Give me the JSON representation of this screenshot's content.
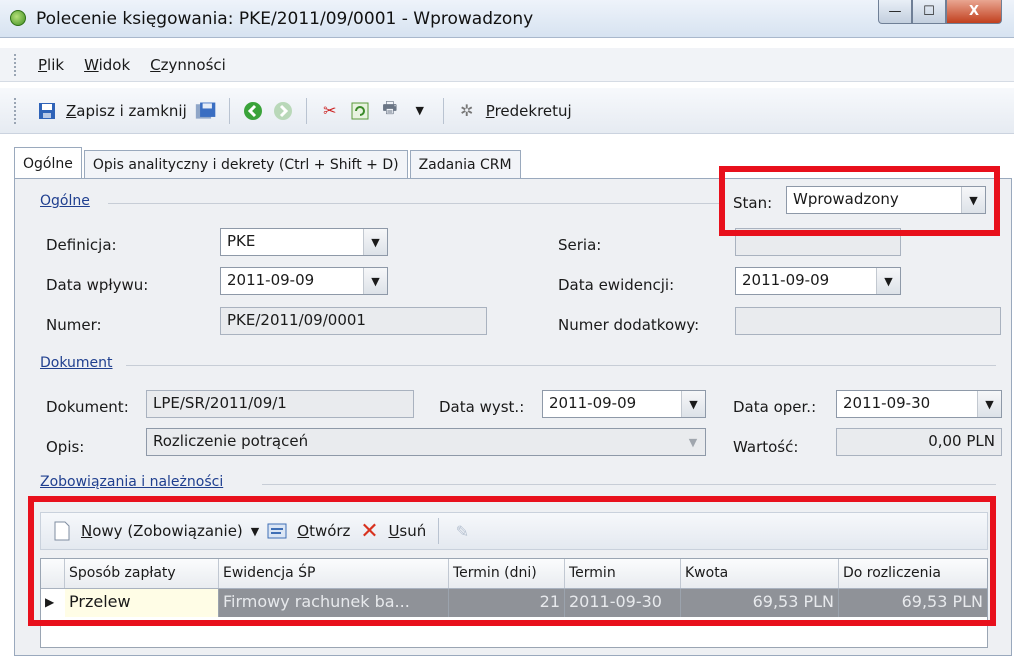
{
  "window": {
    "title": "Polecenie księgowania: PKE/2011/09/0001 - Wprowadzony",
    "min": "—",
    "max": "☐",
    "close": "X"
  },
  "menu": [
    {
      "label_u": "P",
      "label_rest": "lik"
    },
    {
      "label_u": "W",
      "label_rest": "idok"
    },
    {
      "label_u": "C",
      "label_rest": "zynności"
    }
  ],
  "toolbar": {
    "save_close_u": "Z",
    "save_close_rest": "apisz i zamknij",
    "predekretuj_u": "P",
    "predekretuj_rest": "redekretuj"
  },
  "tabs": [
    "Ogólne",
    "Opis analityczny i dekrety (Ctrl + Shift + D)",
    "Zadania CRM"
  ],
  "general": {
    "section": "Ogólne",
    "stan_label": "Stan:",
    "stan_value": "Wprowadzony",
    "definicja_label": "Definicja:",
    "definicja_value": "PKE",
    "seria_label": "Seria:",
    "seria_value": "",
    "data_wplywu_label": "Data wpływu:",
    "data_wplywu_value": "2011-09-09",
    "data_ewidencji_label": "Data ewidencji:",
    "data_ewidencji_value": "2011-09-09",
    "numer_label": "Numer:",
    "numer_value": "PKE/2011/09/0001",
    "numer_dod_label": "Numer dodatkowy:",
    "numer_dod_value": ""
  },
  "document": {
    "section": "Dokument",
    "dokument_label": "Dokument:",
    "dokument_value": "LPE/SR/2011/09/1",
    "data_wyst_label": "Data wyst.:",
    "data_wyst_value": "2011-09-09",
    "data_oper_label": "Data oper.:",
    "data_oper_value": "2011-09-30",
    "opis_label": "Opis:",
    "opis_value": "Rozliczenie potrąceń",
    "wartosc_label": "Wartość:",
    "wartosc_value": "0,00 PLN"
  },
  "liabilities": {
    "section": "Zobowiązania i należności",
    "nowy_u": "N",
    "nowy_rest": "owy (Zobowiązanie)",
    "otworz_u": "O",
    "otworz_rest": "twórz",
    "usun_u": "U",
    "usun_rest": "suń",
    "columns": [
      "Sposób zapłaty",
      "Ewidencja ŚP",
      "Termin (dni)",
      "Termin",
      "Kwota",
      "Do rozliczenia"
    ],
    "rows": [
      {
        "sposob": "Przelew",
        "ewidencja": "Firmowy rachunek ba...",
        "termin_dni": "21",
        "termin": "2011-09-30",
        "kwota": "69,53 PLN",
        "do_rozliczenia": "69,53 PLN"
      }
    ]
  }
}
